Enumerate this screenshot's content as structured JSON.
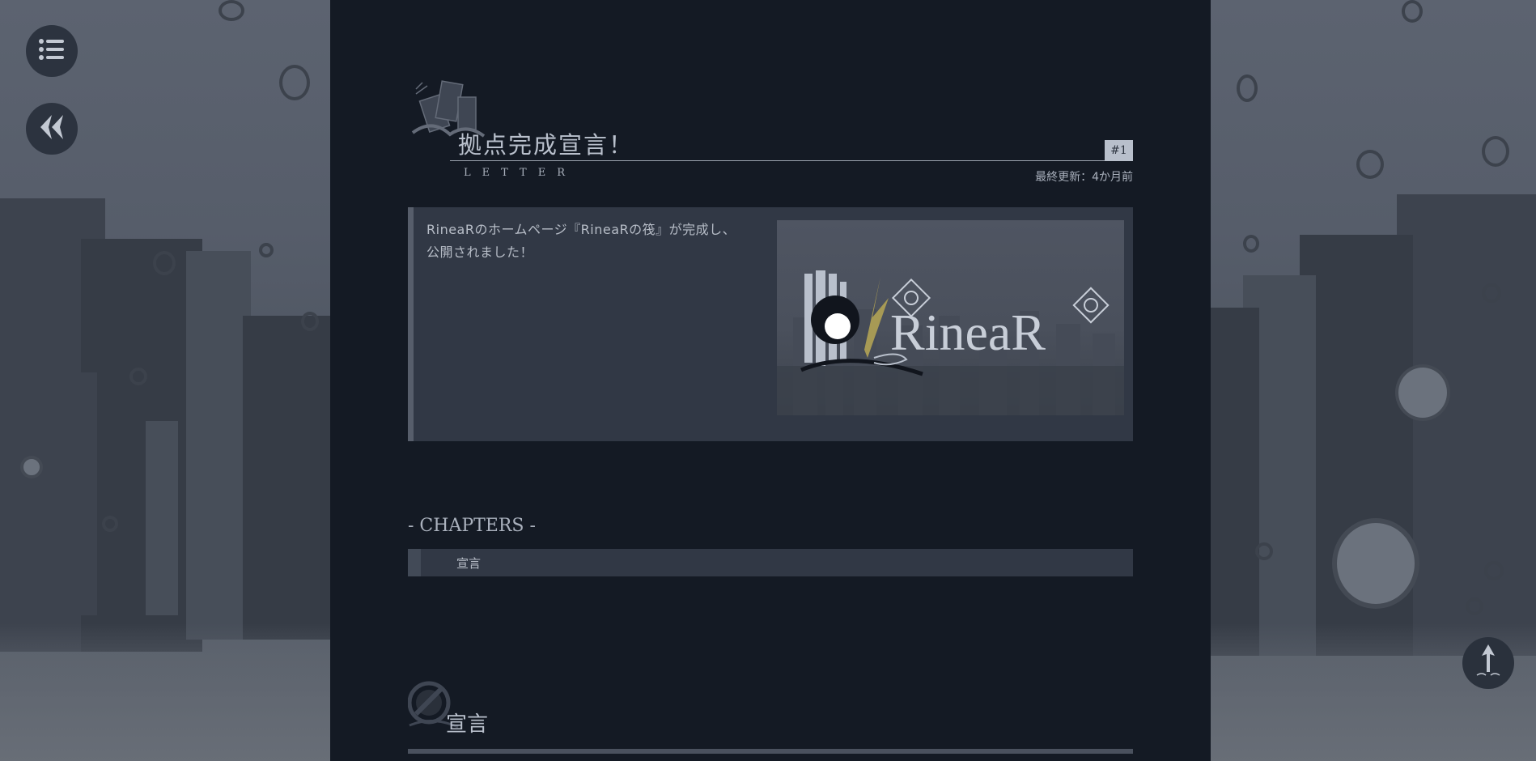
{
  "nav": {
    "menu_icon": "list-icon",
    "back_icon": "double-chevron-left-icon",
    "top_icon": "arrow-up-icon"
  },
  "article": {
    "title": "拠点完成宣言！",
    "subtitle": "LETTER",
    "number_tag": "#1",
    "updated": "最終更新：4か月前",
    "body_line1": "RineaRのホームページ『RineaRの筏』が完成し、",
    "body_line2": "公開されました！",
    "logo_text": "RineaR"
  },
  "chapters": {
    "heading": "- CHAPTERS -",
    "items": [
      {
        "label": "宣言"
      }
    ]
  },
  "section": {
    "title": "宣言"
  },
  "colors": {
    "page_bg": "#141a24",
    "card_bg": "#313845",
    "text": "#b7bdc7",
    "accent": "#b8bfcb",
    "bolt": "#a79a55"
  }
}
